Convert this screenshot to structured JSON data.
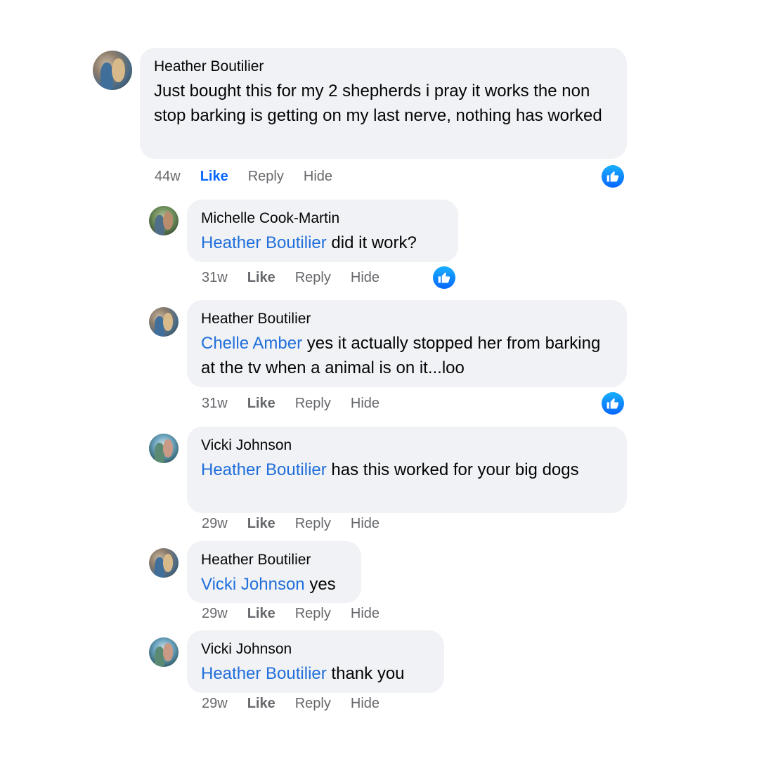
{
  "comments": [
    {
      "author": "Heather Boutilier",
      "mention": "",
      "text": "Just bought this for my 2 shepherds i pray it works the non stop barking is getting on my last nerve, nothing has worked",
      "time": "44w",
      "like": "Like",
      "reply": "Reply",
      "hide": "Hide",
      "liked_by_me": true,
      "reaction": "like-reaction-icon"
    },
    {
      "author": "Michelle Cook-Martin",
      "mention": "Heather Boutilier",
      "text": " did it work?",
      "time": "31w",
      "like": "Like",
      "reply": "Reply",
      "hide": "Hide",
      "liked_by_me": false,
      "reaction": "like-reaction-icon"
    },
    {
      "author": "Heather Boutilier",
      "mention": "Chelle Amber",
      "text": " yes it actually stopped her from barking at the tv when a animal is on it...loo",
      "time": "31w",
      "like": "Like",
      "reply": "Reply",
      "hide": "Hide",
      "liked_by_me": false,
      "reaction": "like-reaction-icon"
    },
    {
      "author": "Vicki Johnson",
      "mention": "Heather Boutilier",
      "text": " has this worked for your big dogs",
      "time": "29w",
      "like": "Like",
      "reply": "Reply",
      "hide": "Hide",
      "liked_by_me": false
    },
    {
      "author": "Heather Boutilier",
      "mention": "Vicki Johnson",
      "text": " yes",
      "time": "29w",
      "like": "Like",
      "reply": "Reply",
      "hide": "Hide",
      "liked_by_me": false
    },
    {
      "author": "Vicki Johnson",
      "mention": "Heather Boutilier",
      "text": " thank you",
      "time": "29w",
      "like": "Like",
      "reply": "Reply",
      "hide": "Hide",
      "liked_by_me": false
    }
  ],
  "colors": {
    "mention": "#216fdb",
    "like_active": "#0866ff",
    "bubble": "#f0f2f5",
    "meta": "#65676b"
  }
}
